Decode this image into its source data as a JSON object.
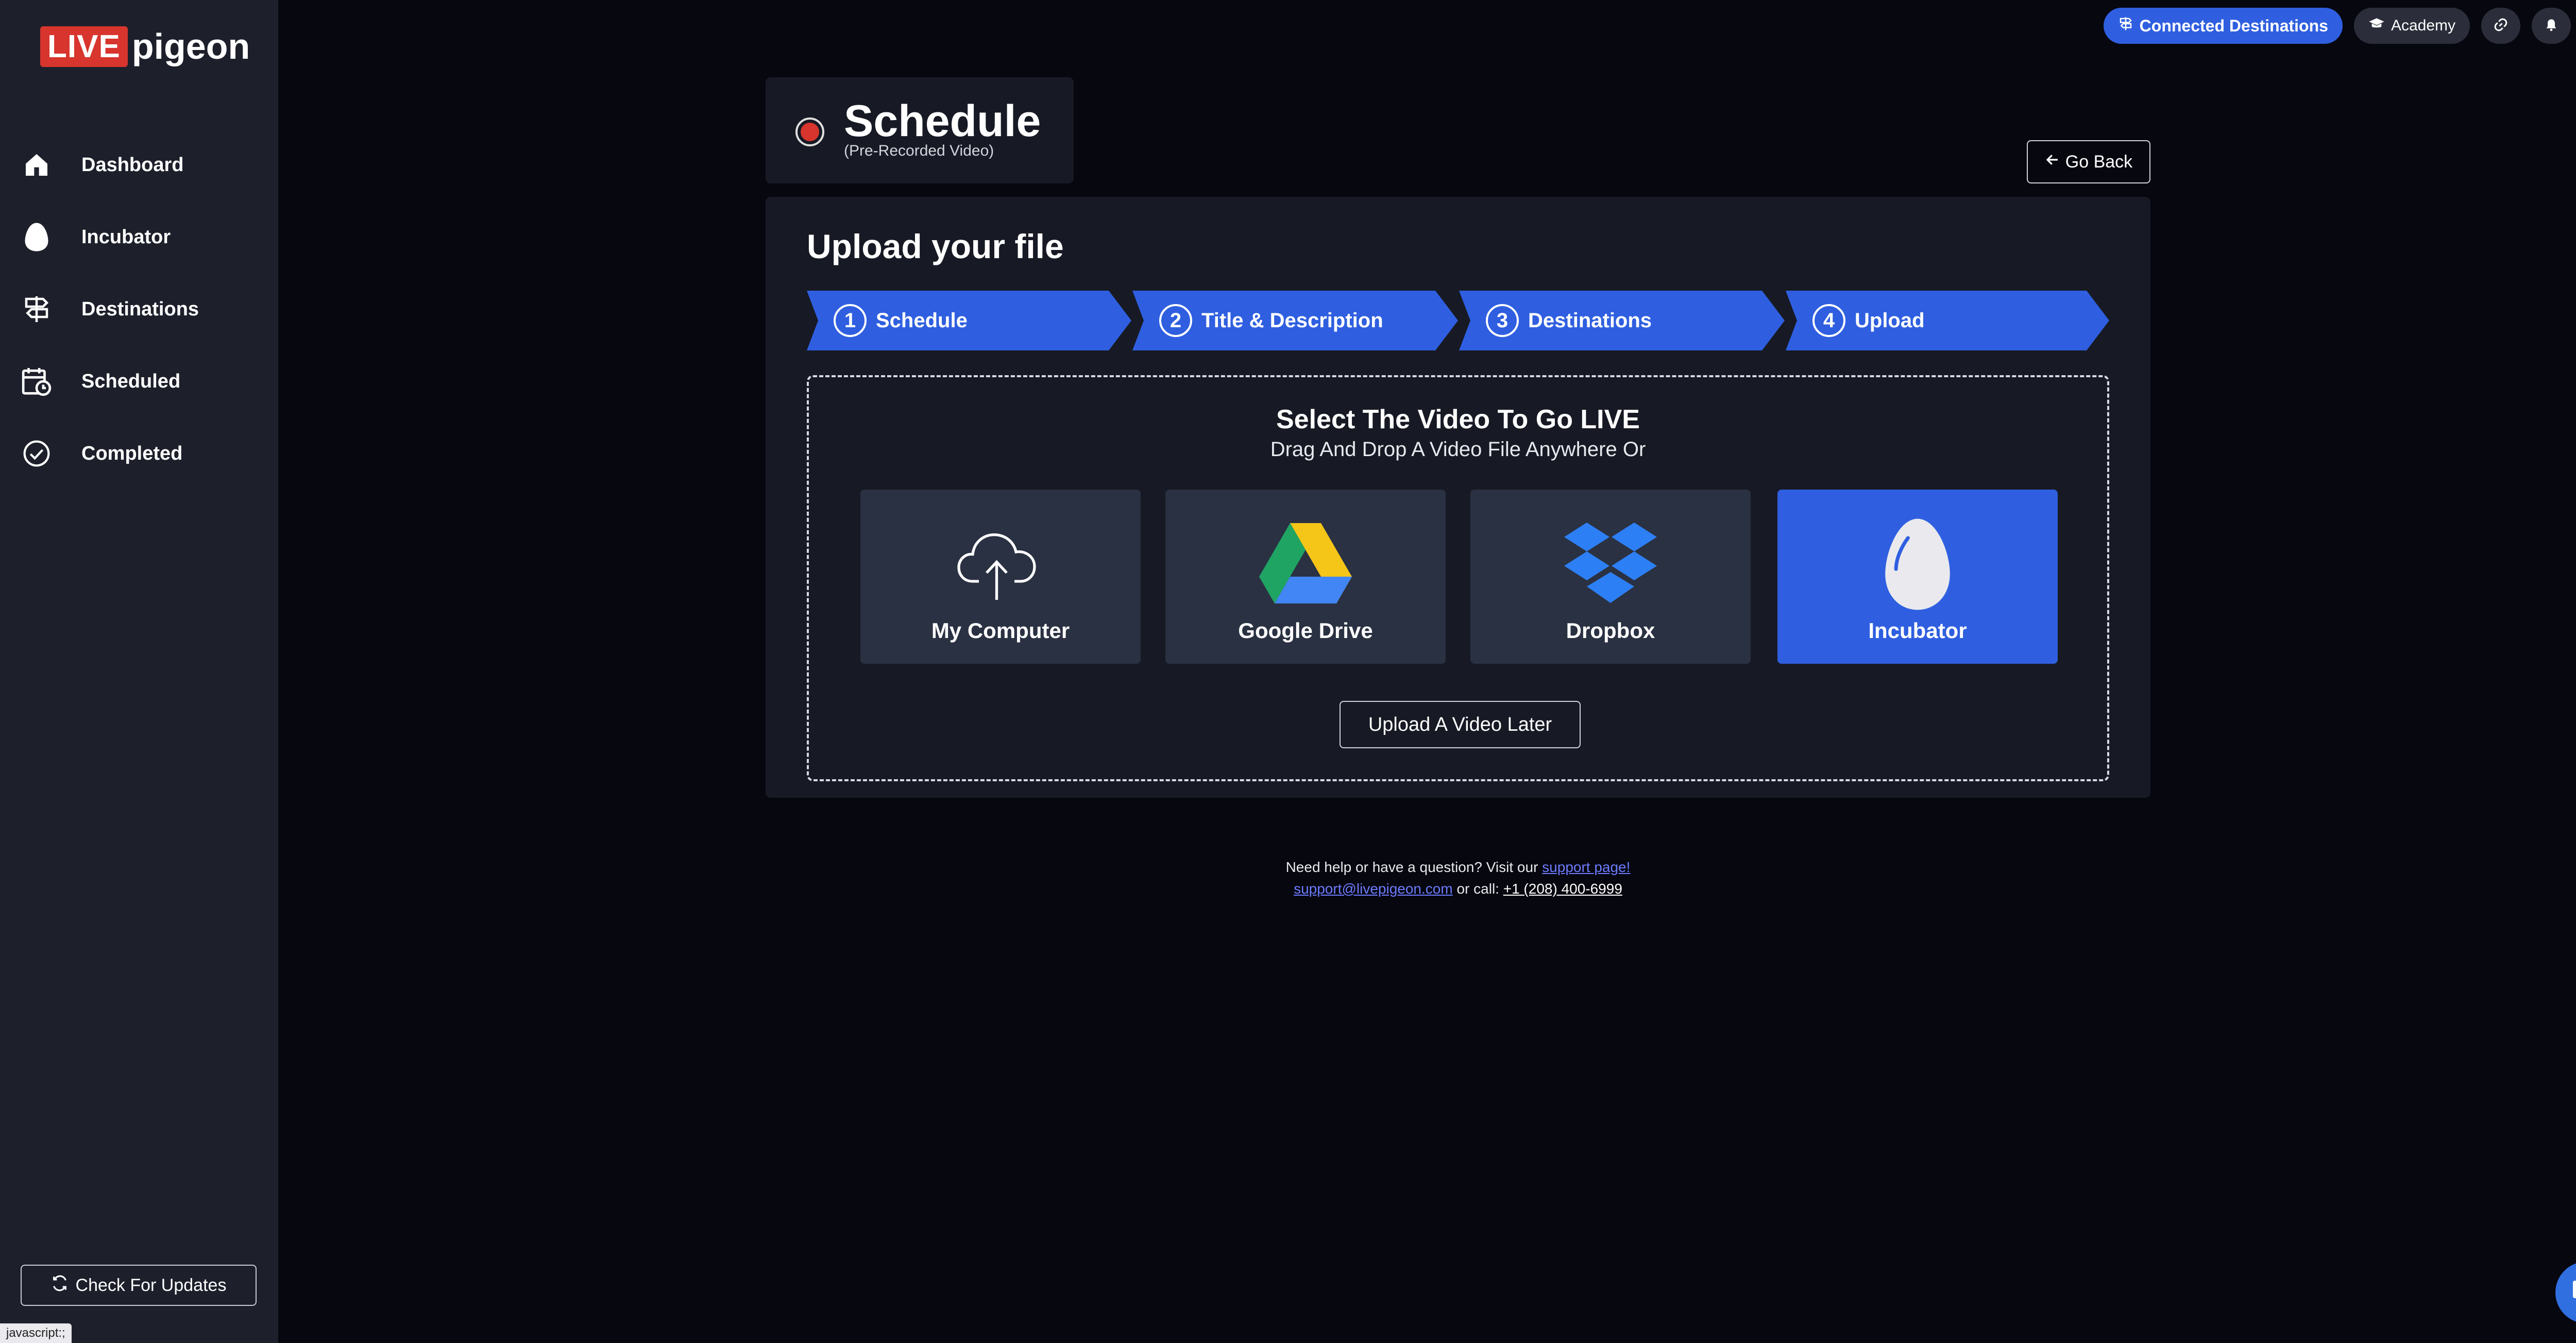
{
  "brand": {
    "live": "LIVE",
    "pigeon": "pigeon"
  },
  "sidebar": {
    "items": [
      {
        "label": "Dashboard",
        "icon": "home-icon"
      },
      {
        "label": "Incubator",
        "icon": "egg-icon"
      },
      {
        "label": "Destinations",
        "icon": "signpost-icon"
      },
      {
        "label": "Scheduled",
        "icon": "calendar-clock-icon"
      },
      {
        "label": "Completed",
        "icon": "check-circle-icon"
      }
    ],
    "check_updates": "Check For Updates"
  },
  "status_bar": {
    "url": "javascript:;"
  },
  "topbar": {
    "connected_destinations": "Connected Destinations",
    "academy": "Academy"
  },
  "header": {
    "title": "Schedule",
    "subtitle": "(Pre-Recorded Video)",
    "go_back": "Go Back"
  },
  "panel": {
    "title": "Upload your file",
    "steps": [
      {
        "num": "1",
        "label": "Schedule"
      },
      {
        "num": "2",
        "label": "Title & Description"
      },
      {
        "num": "3",
        "label": "Destinations"
      },
      {
        "num": "4",
        "label": "Upload"
      }
    ],
    "dropzone": {
      "title": "Select The Video To Go LIVE",
      "subtitle": "Drag And Drop A Video File Anywhere Or",
      "sources": [
        {
          "label": "My Computer",
          "icon": "cloud-upload-icon"
        },
        {
          "label": "Google Drive",
          "icon": "google-drive-icon"
        },
        {
          "label": "Dropbox",
          "icon": "dropbox-icon"
        },
        {
          "label": "Incubator",
          "icon": "egg-icon",
          "selected": true
        }
      ],
      "later": "Upload A Video Later"
    }
  },
  "footer": {
    "line1": "Need help or have a question? Visit our",
    "support_link": "support page!",
    "email": "support@livepigeon.com",
    "or_call": "or call:",
    "phone": "+1 (208) 400-6999"
  },
  "colors": {
    "accent": "#2f5fe0",
    "brand_red": "#d7352d",
    "background": "#07070f",
    "sidebar": "#1d202b",
    "panel": "#171a24"
  }
}
